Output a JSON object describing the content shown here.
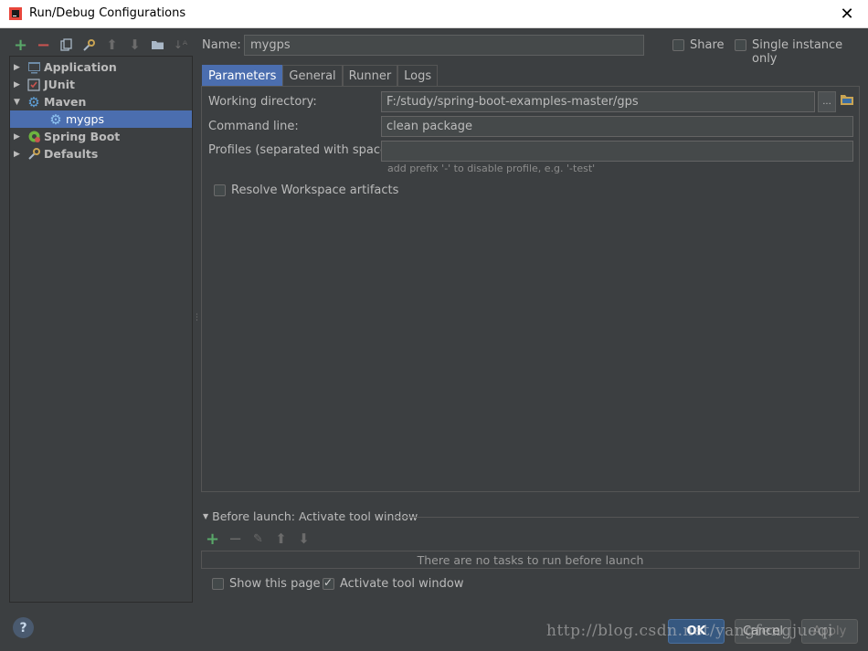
{
  "window": {
    "title": "Run/Debug Configurations",
    "close_glyph": "✕"
  },
  "toolbar": {
    "icons": [
      "add-icon",
      "remove-icon",
      "copy-icon",
      "edit-defaults-icon",
      "move-up-icon",
      "move-down-icon",
      "folder-icon",
      "sort-icon"
    ]
  },
  "tree": {
    "items": [
      {
        "label": "Application",
        "icon": "application-icon",
        "expanded": false
      },
      {
        "label": "JUnit",
        "icon": "junit-icon",
        "expanded": false
      },
      {
        "label": "Maven",
        "icon": "maven-gear-icon",
        "expanded": true
      },
      {
        "label": "mygps",
        "icon": "maven-gear-icon",
        "selected": true
      },
      {
        "label": "Spring Boot",
        "icon": "spring-boot-icon",
        "expanded": false
      },
      {
        "label": "Defaults",
        "icon": "defaults-wrench-icon",
        "expanded": false
      }
    ]
  },
  "name": {
    "label": "Name:",
    "value": "mygps"
  },
  "share": {
    "label": "Share",
    "checked": false
  },
  "single_instance": {
    "label": "Single instance only",
    "checked": false
  },
  "tabs": [
    {
      "label": "Parameters",
      "active": true
    },
    {
      "label": "General",
      "active": false
    },
    {
      "label": "Runner",
      "active": false
    },
    {
      "label": "Logs",
      "active": false
    }
  ],
  "parameters": {
    "working_directory": {
      "label": "Working directory:",
      "value": "F:/study/spring-boot-examples-master/gps"
    },
    "browse_label": "...",
    "command_line": {
      "label": "Command line:",
      "value": "clean package"
    },
    "profiles": {
      "label": "Profiles (separated with space):",
      "value": "",
      "hint": "add prefix '-' to disable profile, e.g. '-test'"
    },
    "resolve_workspace": {
      "label": "Resolve Workspace artifacts",
      "checked": false
    }
  },
  "before_launch": {
    "header": "Before launch: Activate tool window",
    "empty_text": "There are no tasks to run before launch",
    "show_this_page": {
      "label": "Show this page",
      "checked": false
    },
    "activate_tool_window": {
      "label": "Activate tool window",
      "checked": true
    }
  },
  "buttons": {
    "help": "?",
    "ok": "OK",
    "cancel": "Cancel",
    "apply": "Apply"
  },
  "watermark": "http://blog.csdn.net/yangfengjueqi",
  "colors": {
    "background": "#3c3f41",
    "selection": "#4b6eaf",
    "add_green": "#59a869",
    "remove_red": "#c75450"
  }
}
